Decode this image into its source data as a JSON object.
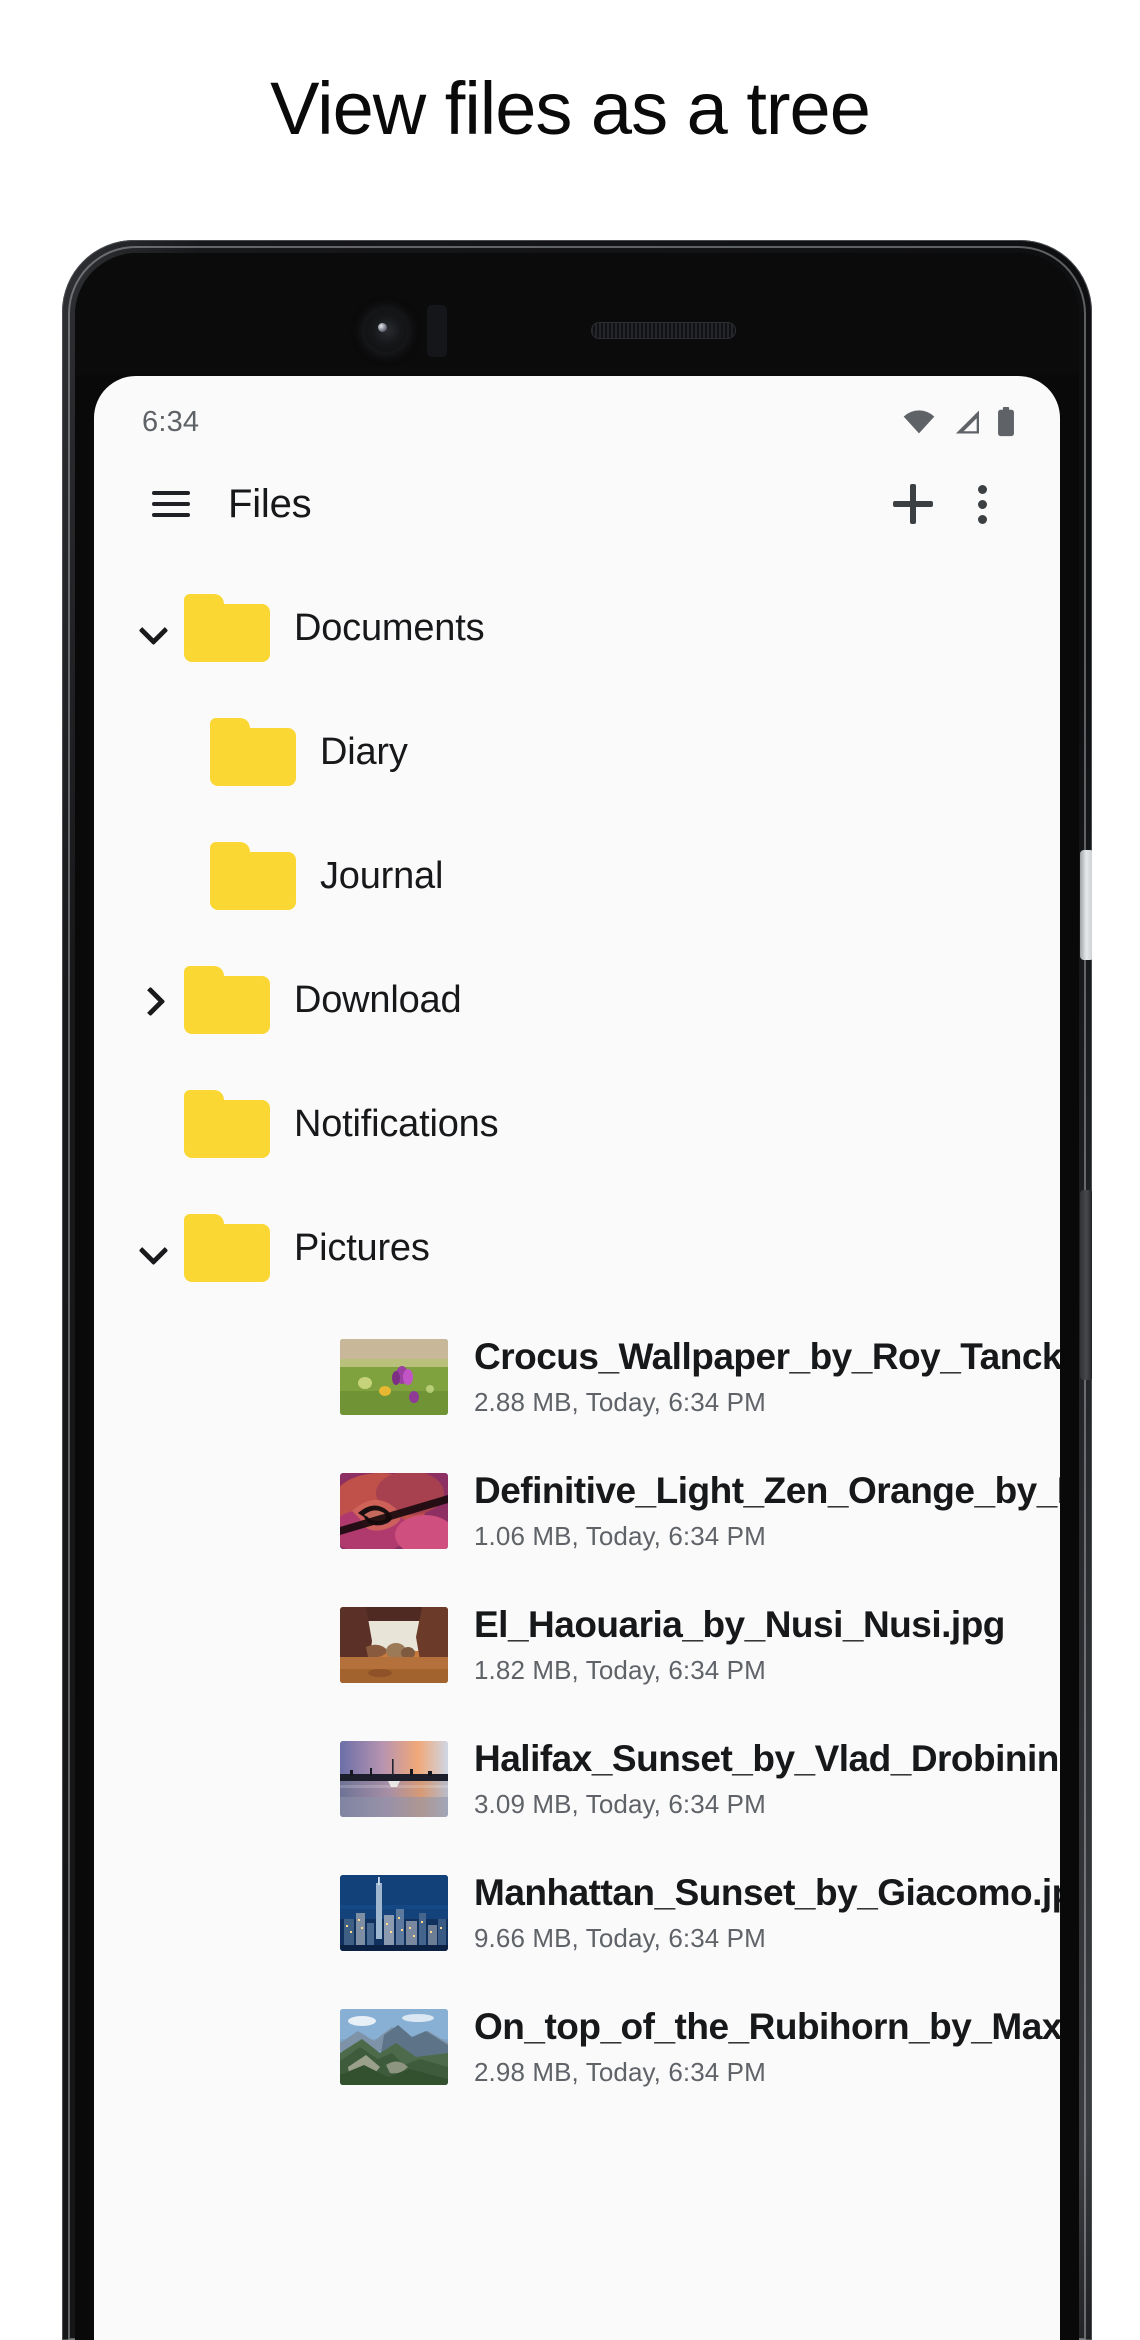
{
  "promo": {
    "headline": "View files as a tree"
  },
  "status_bar": {
    "time": "6:34",
    "icons": [
      "wifi-icon",
      "cellular-signal-icon",
      "battery-icon"
    ]
  },
  "app_bar": {
    "menu_icon": "hamburger-menu-icon",
    "title": "Files",
    "add_icon": "plus-icon",
    "overflow_icon": "more-vertical-icon"
  },
  "colors": {
    "folder_yellow": "#FBD734",
    "text_primary": "#17181a",
    "text_secondary": "#5f6368",
    "screen_background": "#fafafb"
  },
  "tree": {
    "folders": [
      {
        "label": "Documents",
        "depth": 1,
        "chevron": "down",
        "icon": "folder-icon"
      },
      {
        "label": "Diary",
        "depth": 2,
        "chevron": "none",
        "icon": "folder-icon"
      },
      {
        "label": "Journal",
        "depth": 2,
        "chevron": "none",
        "icon": "folder-icon"
      },
      {
        "label": "Download",
        "depth": 1,
        "chevron": "right",
        "icon": "folder-icon"
      },
      {
        "label": "Notifications",
        "depth": 1,
        "chevron": "none",
        "icon": "folder-icon"
      },
      {
        "label": "Pictures",
        "depth": 1,
        "chevron": "down",
        "icon": "folder-icon"
      }
    ],
    "files": [
      {
        "name": "Crocus_Wallpaper_by_Roy_Tanck.jpg",
        "size": "2.88 MB",
        "date": "Today",
        "time": "6:34 PM",
        "thumb": "crocus-flowers-thumbnail"
      },
      {
        "name": "Definitive_Light_Zen_Orange_by_Marco.jpg",
        "size": "1.06 MB",
        "date": "Today",
        "time": "6:34 PM",
        "thumb": "abstract-pink-thumbnail"
      },
      {
        "name": "El_Haouaria_by_Nusi_Nusi.jpg",
        "size": "1.82 MB",
        "date": "Today",
        "time": "6:34 PM",
        "thumb": "canyon-rocks-thumbnail"
      },
      {
        "name": "Halifax_Sunset_by_Vlad_Drobinin.jpg",
        "size": "3.09 MB",
        "date": "Today",
        "time": "6:34 PM",
        "thumb": "harbor-sunset-thumbnail"
      },
      {
        "name": "Manhattan_Sunset_by_Giacomo.jpg",
        "size": "9.66 MB",
        "date": "Today",
        "time": "6:34 PM",
        "thumb": "city-skyline-thumbnail"
      },
      {
        "name": "On_top_of_the_Rubihorn_by_Max.jpg",
        "size": "2.98 MB",
        "date": "Today",
        "time": "6:34 PM",
        "thumb": "mountain-ridge-thumbnail"
      }
    ]
  },
  "hardware": {
    "front_camera": "front-camera-icon",
    "sensor": "proximity-sensor-icon",
    "earpiece": "earpiece-speaker-icon",
    "power_button": "power-button",
    "volume_button": "volume-rocker-button"
  }
}
